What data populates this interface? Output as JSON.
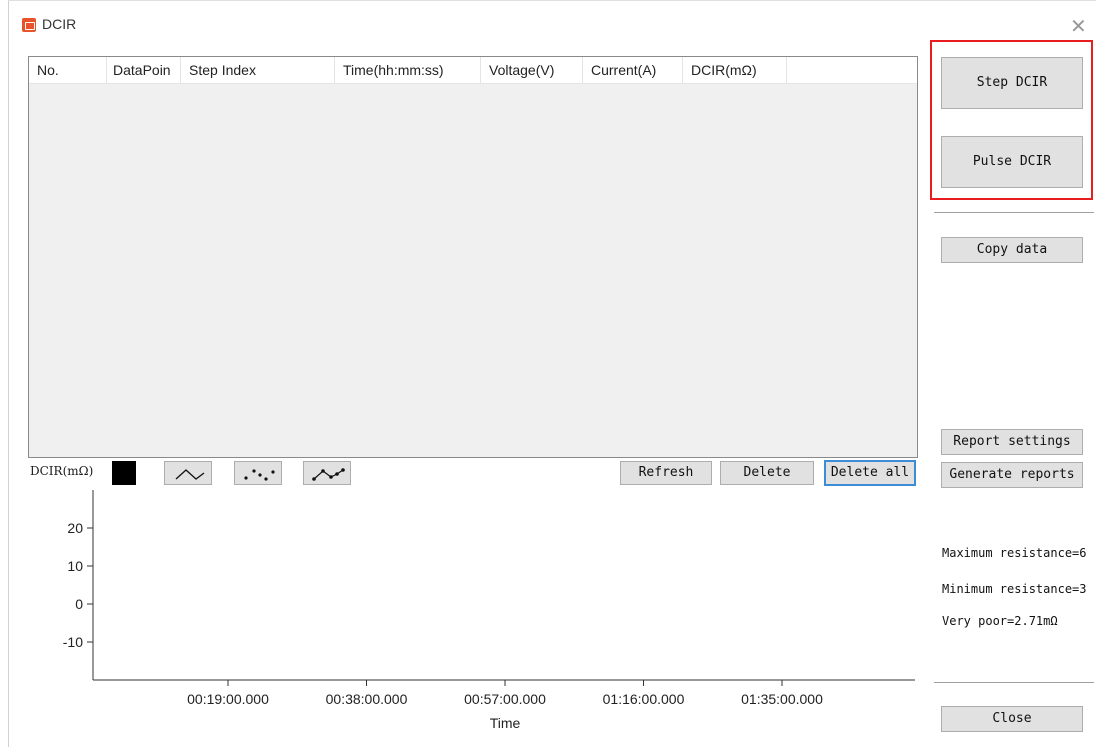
{
  "window": {
    "title": "DCIR",
    "close_glyph": "✕"
  },
  "table": {
    "columns": [
      "No.",
      "DataPoin",
      "Step Index",
      "Time(hh:mm:ss)",
      "Voltage(V)",
      "Current(A)",
      "DCIR(mΩ)",
      ""
    ]
  },
  "chart_toolbar": {
    "label": "DCIR(mΩ)",
    "swatch_color": "#000000",
    "styles": [
      "line-style-icon",
      "scatter-style-icon",
      "line-scatter-style-icon"
    ],
    "refresh": "Refresh",
    "delete": "Delete",
    "delete_all": "Delete all"
  },
  "right_panel": {
    "step_dcir": "Step DCIR",
    "pulse_dcir": "Pulse DCIR",
    "copy_data": "Copy data",
    "report_settings": "Report settings",
    "generate_reports": "Generate reports",
    "max_resistance": "Maximum resistance=6",
    "min_resistance": "Minimum resistance=3",
    "very_poor": "Very poor=2.71mΩ",
    "close": "Close",
    "highlight_color": "#e81e1e"
  },
  "chart_data": {
    "type": "line",
    "xlabel": "Time",
    "ylabel": "",
    "y_ticks": [
      20,
      10,
      0,
      -10
    ],
    "x_ticks": [
      "00:19:00.000",
      "00:38:00.000",
      "00:57:00.000",
      "01:16:00.000",
      "01:35:00.000"
    ],
    "series": []
  }
}
